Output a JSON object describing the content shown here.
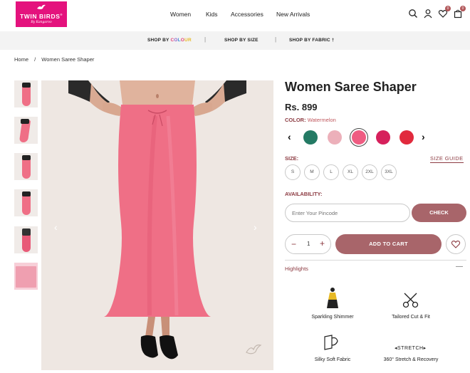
{
  "header": {
    "logo": {
      "name": "TWIN BIRDS",
      "tagline": "By Kangaroo",
      "mark": "®"
    },
    "nav": [
      "Women",
      "Kids",
      "Accessories",
      "New Arrivals"
    ],
    "icons": [
      "search-icon",
      "user-icon",
      "heart-icon",
      "bag-icon"
    ],
    "wishlist_count": "0",
    "cart_count": "0"
  },
  "subnav": {
    "shop_by_colour_prefix": "SHOP BY ",
    "colour_letters": [
      "C",
      "O",
      "L",
      "O",
      "U",
      "R"
    ],
    "shop_by_size": "SHOP BY SIZE",
    "shop_by_fabric": "SHOP BY FABRIC",
    "separator": "|"
  },
  "breadcrumb": {
    "home": "Home",
    "sep": "/",
    "current": "Women Saree Shaper"
  },
  "product": {
    "title": "Women Saree Shaper",
    "price": "Rs. 899",
    "color_label": "COLOR:",
    "color_value": "Watermelon",
    "swatches": [
      {
        "name": "teal",
        "color": "#247a64"
      },
      {
        "name": "light-pink",
        "color": "#ecb0ba"
      },
      {
        "name": "watermelon",
        "color": "#ef5c82",
        "selected": true
      },
      {
        "name": "magenta",
        "color": "#d6205c"
      },
      {
        "name": "red",
        "color": "#e12a3d"
      }
    ],
    "size_label": "SIZE:",
    "size_guide": "SIZE GUIDE",
    "sizes": [
      "S",
      "M",
      "L",
      "XL",
      "2XL",
      "3XL"
    ],
    "availability_label": "AVAILABILITY:",
    "pincode_placeholder": "Enter Your Pincode",
    "check_label": "CHECK",
    "quantity": "1",
    "add_to_cart": "ADD TO CART",
    "highlights_label": "Highlights",
    "highlights_toggle": "—",
    "features": [
      {
        "icon": "shimmer-icon",
        "label": "Sparkling Shimmer"
      },
      {
        "icon": "scissors-icon",
        "label": "Tailored Cut & Fit"
      },
      {
        "icon": "fabric-icon",
        "label": "Silky Soft Fabric"
      },
      {
        "icon": "stretch-icon",
        "label": "360° Stretch & Recovery",
        "icon_text": "STRETCH"
      }
    ]
  },
  "colors": {
    "accent": "#a8656a",
    "accent_text": "#8c3b42",
    "brand": "#e4127d",
    "skirt": "#ef6f86"
  }
}
